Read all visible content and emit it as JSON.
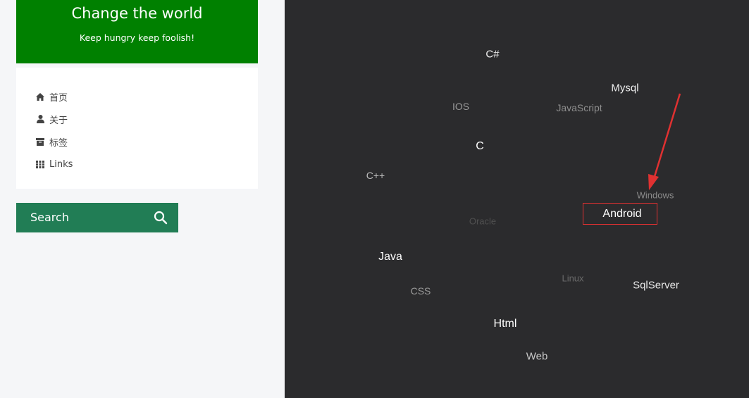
{
  "sidebar": {
    "title": "Change the world",
    "subtitle": "Keep hungry keep foolish!",
    "header_color": "#008000",
    "nav": [
      {
        "label": "首页",
        "icon": "home-icon"
      },
      {
        "label": "关于",
        "icon": "user-icon"
      },
      {
        "label": "标签",
        "icon": "archive-icon"
      },
      {
        "label": "Links",
        "icon": "grid-icon"
      }
    ],
    "search": {
      "label": "Search",
      "icon": "search-icon",
      "color": "#217d55"
    }
  },
  "tag_cloud": {
    "background": "#2b2b2d",
    "highlight_color": "#e03131",
    "tags": [
      {
        "text": "C#"
      },
      {
        "text": "Mysql"
      },
      {
        "text": "IOS"
      },
      {
        "text": "JavaScript"
      },
      {
        "text": "C"
      },
      {
        "text": "C++"
      },
      {
        "text": "Windows"
      },
      {
        "text": "Android"
      },
      {
        "text": "Oracle"
      },
      {
        "text": "Java"
      },
      {
        "text": "Linux"
      },
      {
        "text": "SqlServer"
      },
      {
        "text": "CSS"
      },
      {
        "text": "Html"
      },
      {
        "text": "Web"
      }
    ]
  }
}
